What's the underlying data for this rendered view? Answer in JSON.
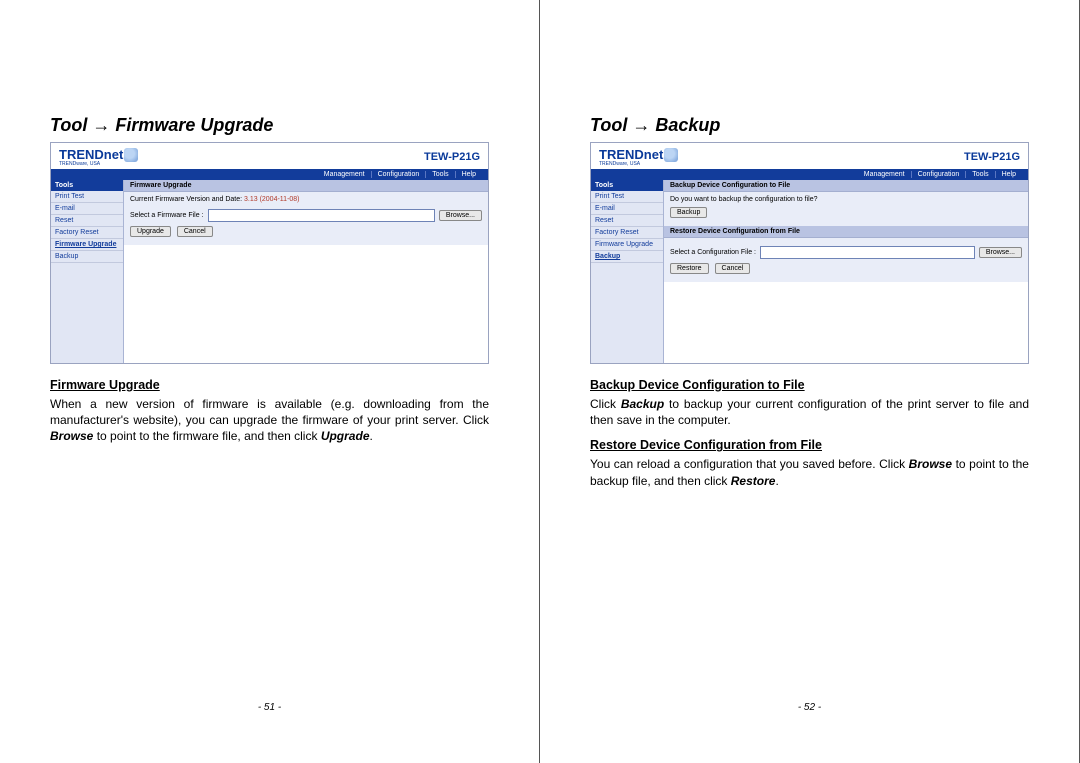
{
  "left": {
    "title": "Tool → Firmware Upgrade",
    "screenshot": {
      "brand": "TRENDnet",
      "brand_tag": "TRENDware, USA",
      "model": "TEW-P21G",
      "nav": [
        "Management",
        "Configuration",
        "Tools",
        "Help"
      ],
      "sidebar_head": "Tools",
      "sidebar": [
        "Print Test",
        "E-mail",
        "Reset",
        "Factory Reset",
        "Firmware Upgrade",
        "Backup"
      ],
      "selected_index": 4,
      "panel_head": "Firmware Upgrade",
      "fw_label": "Current Firmware Version and Date:",
      "fw_value": "3.13 (2004-11-08)",
      "file_label": "Select a Firmware File :",
      "browse": "Browse...",
      "btn1": "Upgrade",
      "btn2": "Cancel"
    },
    "subhead": "Firmware Upgrade",
    "para_html": "When a new version of firmware is available (e.g. downloading from the manufacturer's website), you can upgrade the firmware of your print server.  Click <b><i>Browse</i></b> to point to the firmware file, and then click <b><i>Upgrade</i></b>.",
    "pagenum": "- 51 -"
  },
  "right": {
    "title": "Tool → Backup",
    "screenshot": {
      "brand": "TRENDnet",
      "brand_tag": "TRENDware, USA",
      "model": "TEW-P21G",
      "nav": [
        "Management",
        "Configuration",
        "Tools",
        "Help"
      ],
      "sidebar_head": "Tools",
      "sidebar": [
        "Print Test",
        "E-mail",
        "Reset",
        "Factory Reset",
        "Firmware Upgrade",
        "Backup"
      ],
      "selected_index": 5,
      "panel1_head": "Backup Device Configuration to File",
      "panel1_q": "Do you want to backup the configuration to file?",
      "panel1_btn": "Backup",
      "panel2_head": "Restore Device Configuration from File",
      "file_label": "Select a Configuration File :",
      "browse": "Browse...",
      "btn1": "Restore",
      "btn2": "Cancel"
    },
    "subhead1": "Backup Device Configuration to File",
    "para1_html": "Click <b><i>Backup</i></b> to backup your current configuration of the print server to file and then save in the computer.",
    "subhead2": "Restore Device Configuration from File",
    "para2_html": "You can reload a configuration that you saved before.  Click <b><i>Browse</i></b> to point to the backup file, and then click <b><i>Restore</i></b>.",
    "pagenum": "- 52 -"
  }
}
